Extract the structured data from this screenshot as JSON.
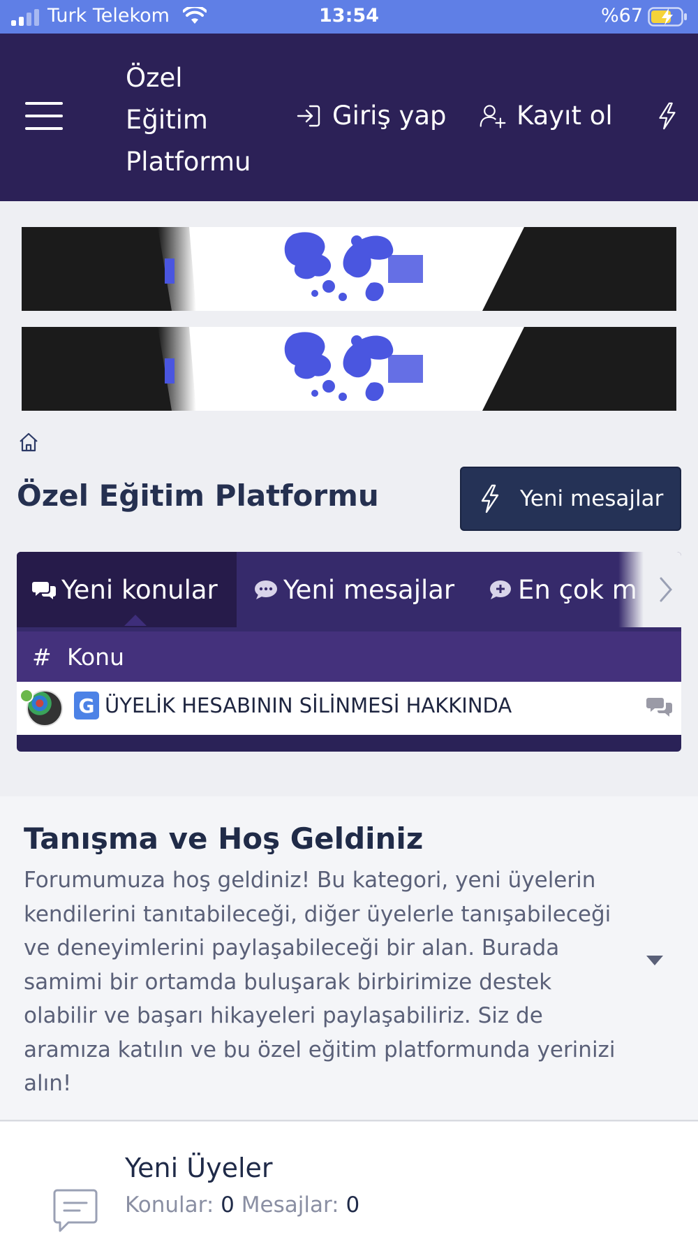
{
  "status_bar": {
    "carrier": "Turk Telekom",
    "time": "13:54",
    "battery": "%67"
  },
  "header": {
    "site_title": "Özel Eğitim Platformu",
    "login_label": "Giriş yap",
    "register_label": "Kayıt ol"
  },
  "page": {
    "title": "Özel Eğitim Platformu",
    "new_posts_button": "Yeni mesajlar"
  },
  "tabs": [
    {
      "label": "Yeni konular",
      "icon": "comments-icon"
    },
    {
      "label": "Yeni mesajlar",
      "icon": "comment-dots-icon"
    },
    {
      "label": "En çok m",
      "icon": "comment-plus-icon"
    }
  ],
  "thread_table": {
    "column_label": "Konu",
    "rows": [
      {
        "prefix": "G",
        "title": "ÜYELİK HESABININ SİLİNMESİ HAKKINDA"
      }
    ]
  },
  "category": {
    "title": "Tanışma ve Hoş Geldiniz",
    "description": "Forumumuza hoş geldiniz! Bu kategori, yeni üyelerin kendilerini tanıtabileceği, diğer üyelerle tanışabileceği ve deneyimlerini paylaşabileceği bir alan. Burada samimi bir ortamda buluşarak birbirimize destek olabilir ve başarı hikayeleri paylaşabiliriz. Siz de aramıza katılın ve bu özel eğitim platformunda yerinizi alın!"
  },
  "forum": {
    "title": "Yeni Üyeler",
    "threads_label": "Konular:",
    "threads_value": "0",
    "messages_label": "Mesajlar:",
    "messages_value": "0"
  },
  "colors": {
    "status_bar": "#5f7fe6",
    "header": "#2c2157",
    "accent_button": "#253256",
    "tab_bar": "#362a6b",
    "column_header": "#44317c"
  }
}
